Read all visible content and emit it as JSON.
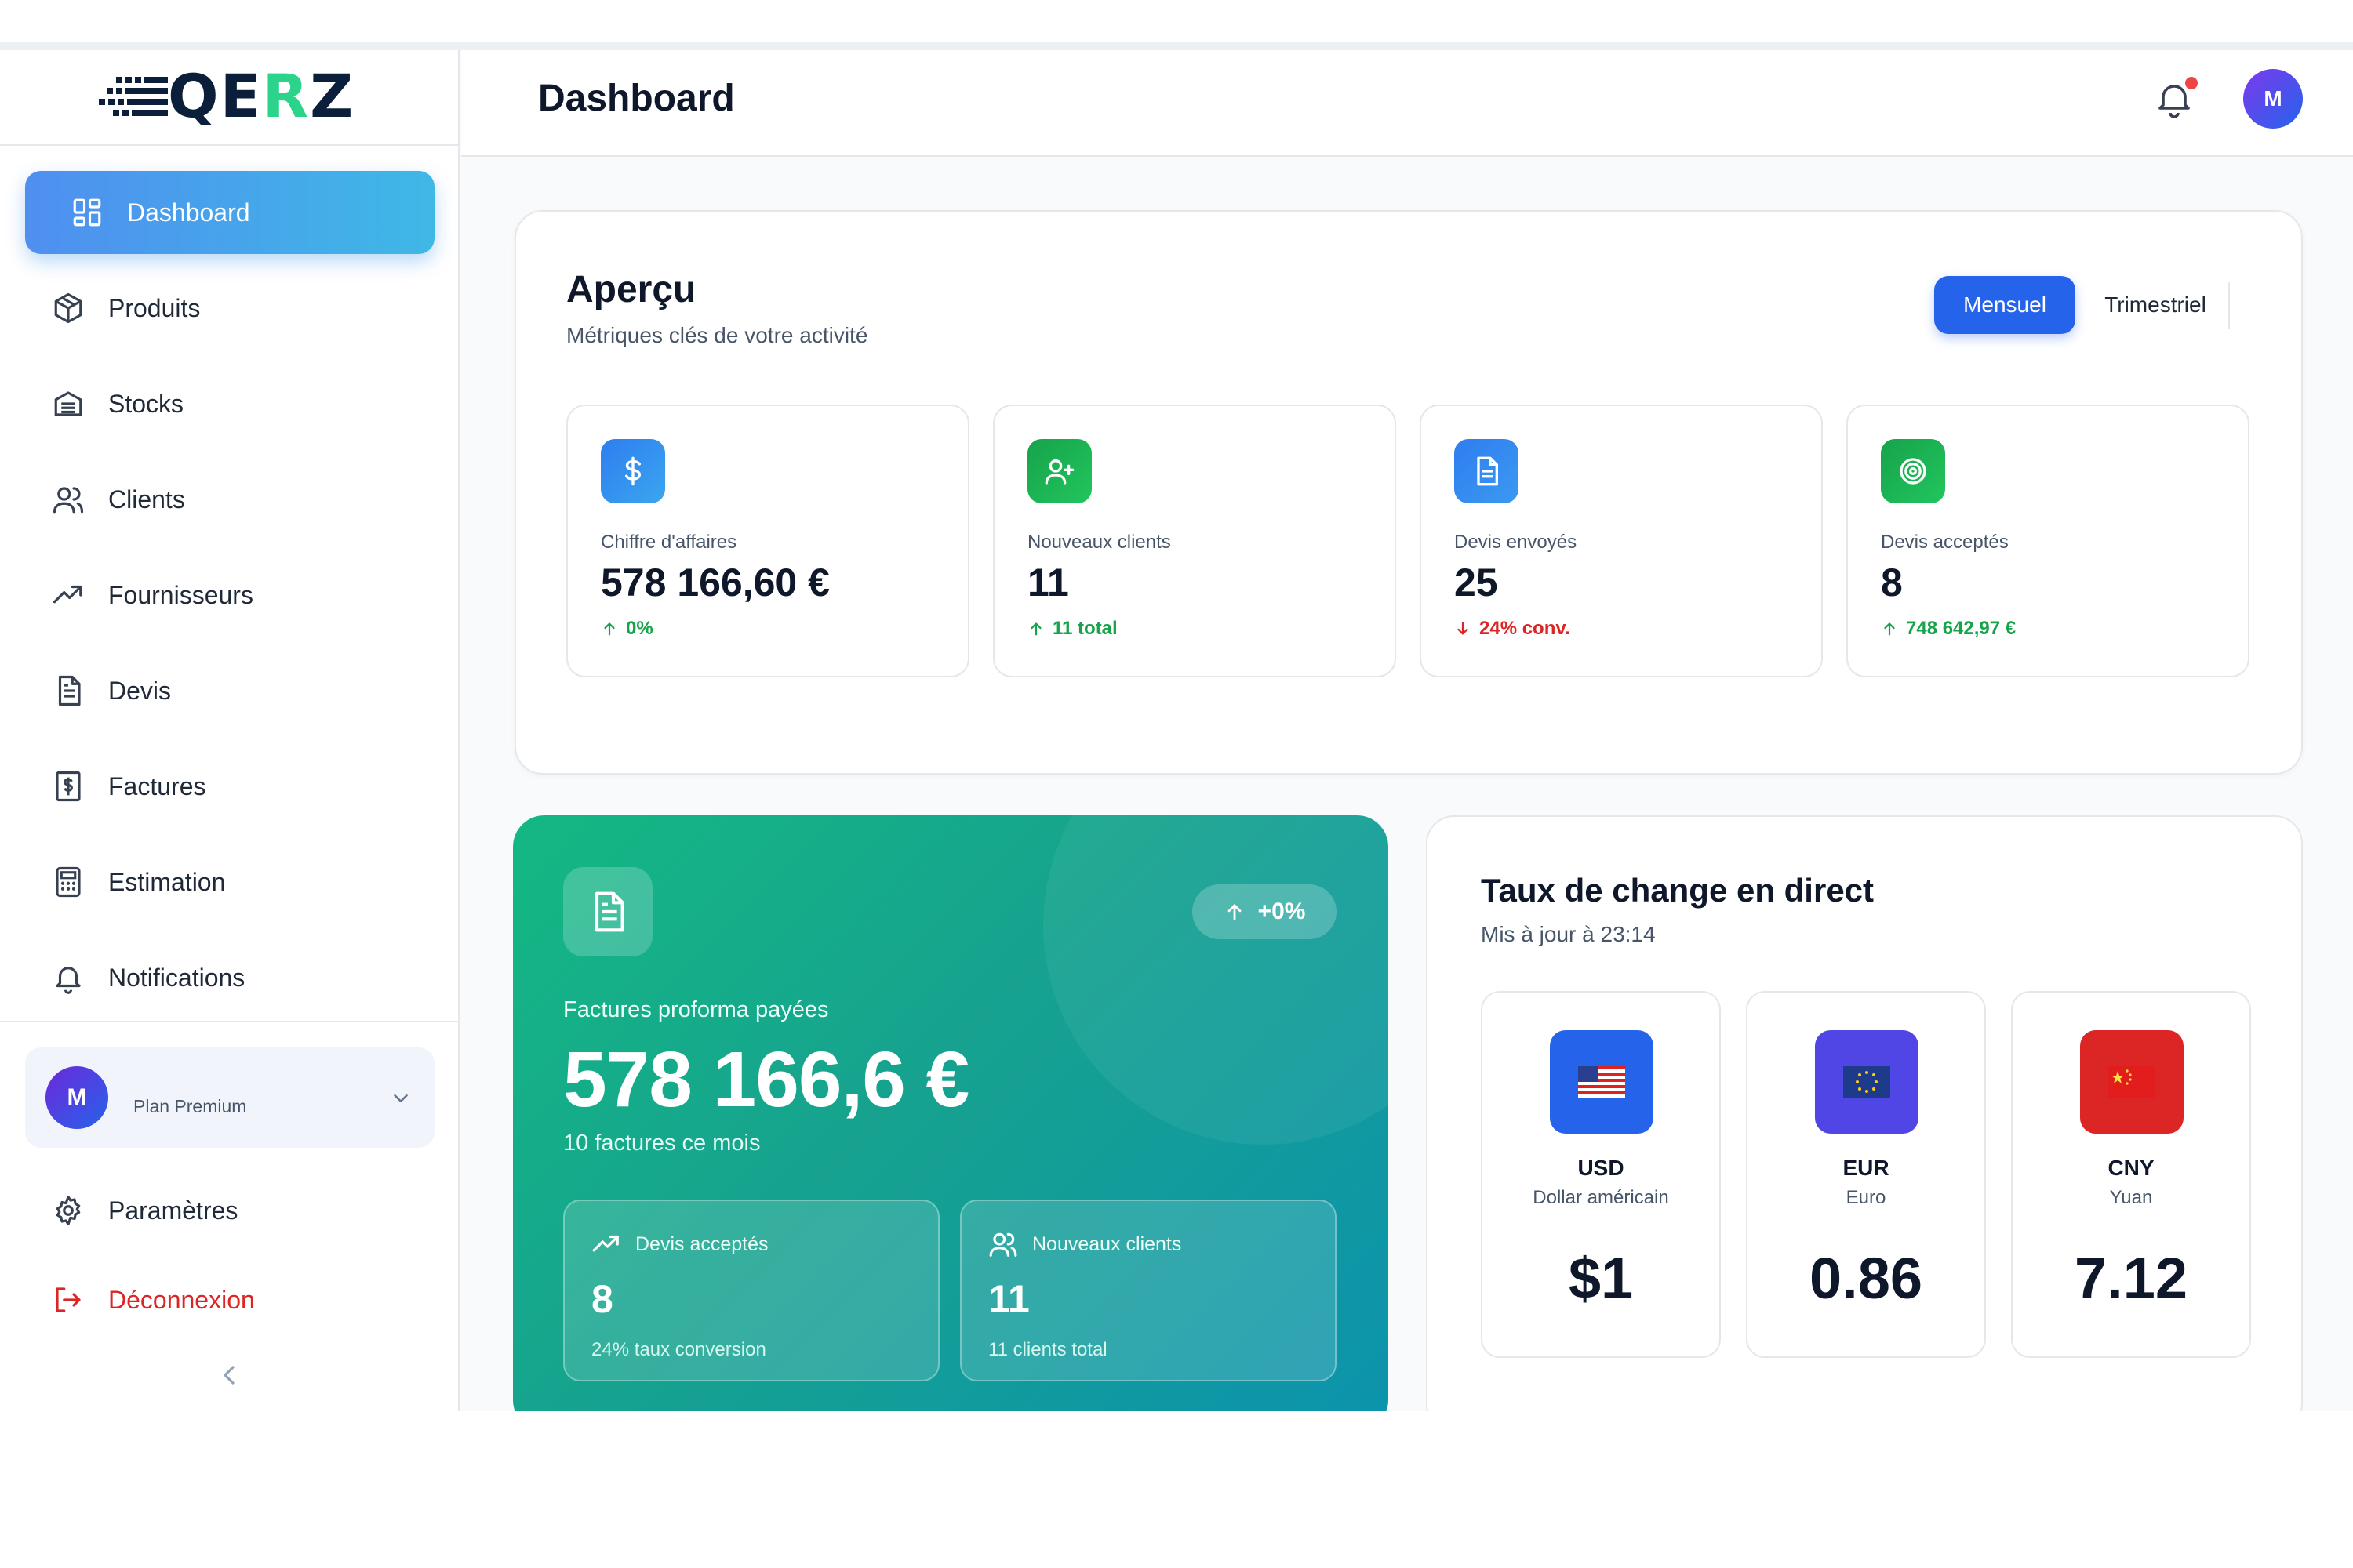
{
  "brand": {
    "logo_text_1": "QE",
    "logo_text_2": "R",
    "logo_text_3": "Z",
    "accent": "#2bd48a",
    "navy": "#0b1f3a"
  },
  "sidebar": {
    "items": [
      {
        "label": "Dashboard",
        "icon": "dashboard-grid-icon",
        "active": true
      },
      {
        "label": "Produits",
        "icon": "box-icon"
      },
      {
        "label": "Stocks",
        "icon": "warehouse-icon"
      },
      {
        "label": "Clients",
        "icon": "users-icon"
      },
      {
        "label": "Fournisseurs",
        "icon": "trending-up-icon"
      },
      {
        "label": "Devis",
        "icon": "document-icon"
      },
      {
        "label": "Factures",
        "icon": "invoice-dollar-icon"
      },
      {
        "label": "Estimation",
        "icon": "calculator-icon"
      },
      {
        "label": "Notifications",
        "icon": "bell-icon"
      }
    ],
    "user": {
      "initial": "M",
      "plan": "Plan Premium"
    },
    "settings_label": "Paramètres",
    "logout_label": "Déconnexion"
  },
  "header": {
    "title": "Dashboard",
    "avatar_initial": "M"
  },
  "overview": {
    "title": "Aperçu",
    "subtitle": "Métriques clés de votre activité",
    "period_active": "Mensuel",
    "period_other": "Trimestriel",
    "metrics": [
      {
        "label": "Chiffre d'affaires",
        "value": "578 166,60 €",
        "delta": "0%",
        "direction": "up",
        "color": "#2563eb"
      },
      {
        "label": "Nouveaux clients",
        "value": "11",
        "delta": "11 total",
        "direction": "up",
        "color": "#16a34a"
      },
      {
        "label": "Devis envoyés",
        "value": "25",
        "delta": "24% conv.",
        "direction": "down",
        "color": "#3b82f6"
      },
      {
        "label": "Devis acceptés",
        "value": "8",
        "delta": "748 642,97 €",
        "direction": "up",
        "color": "#16a34a"
      }
    ]
  },
  "revenue_card": {
    "badge": "+0%",
    "label": "Factures proforma payées",
    "value": "578 166,6 €",
    "sub": "10 factures ce mois",
    "boxes": [
      {
        "title": "Devis acceptés",
        "value": "8",
        "sub": "24% taux conversion"
      },
      {
        "title": "Nouveaux clients",
        "value": "11",
        "sub": "11 clients total"
      }
    ]
  },
  "exchange": {
    "title": "Taux de change en direct",
    "updated": "Mis à jour à 23:14",
    "rates": [
      {
        "code": "USD",
        "name": "Dollar américain",
        "value": "$1",
        "tile": "#2563eb"
      },
      {
        "code": "EUR",
        "name": "Euro",
        "value": "0.86",
        "tile": "#4f46e5"
      },
      {
        "code": "CNY",
        "name": "Yuan",
        "value": "7.12",
        "tile": "#dc2626"
      }
    ]
  }
}
